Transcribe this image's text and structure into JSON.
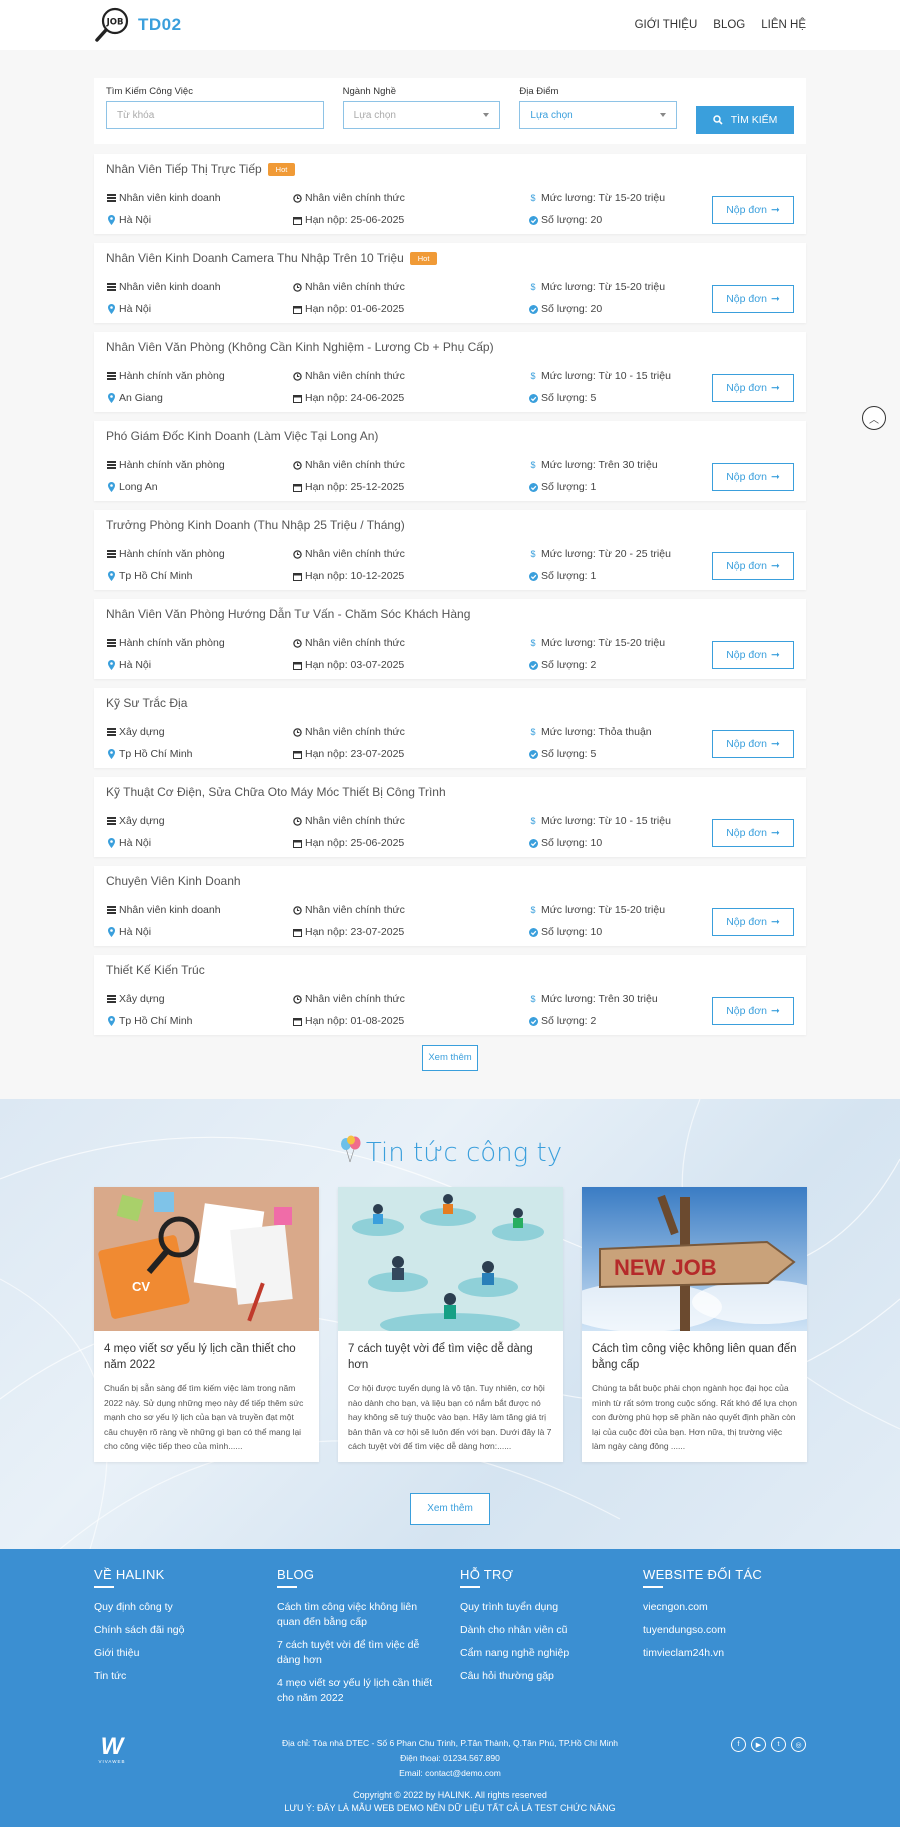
{
  "header": {
    "brand": "TD02",
    "logo_text": "JOB",
    "nav": [
      "GIỚI THIỆU",
      "BLOG",
      "LIÊN HỆ"
    ]
  },
  "search": {
    "keyword_label": "Tìm Kiếm Công Việc",
    "keyword_placeholder": "Từ khóa",
    "industry_label": "Ngành Nghề",
    "industry_value": "Lựa chọn",
    "location_label": "Địa Điểm",
    "location_value": "Lựa chọn",
    "button": "TÌM KIẾM"
  },
  "jobs": [
    {
      "title": "Nhân Viên Tiếp Thị Trực Tiếp",
      "hot": "Hot",
      "category": "Nhân viên kinh doanh",
      "type": "Nhân viên chính thức",
      "salary": "Mức lương: Từ 15-20 triệu",
      "location": "Hà Nội",
      "deadline": "Hạn nộp: 25-06-2025",
      "quantity": "Số lượng: 20",
      "apply": "Nộp đơn"
    },
    {
      "title": "Nhân Viên Kinh Doanh Camera Thu Nhập Trên 10 Triệu",
      "hot": "Hot",
      "category": "Nhân viên kinh doanh",
      "type": "Nhân viên chính thức",
      "salary": "Mức lương: Từ 15-20 triệu",
      "location": "Hà Nội",
      "deadline": "Hạn nộp: 01-06-2025",
      "quantity": "Số lượng: 20",
      "apply": "Nộp đơn"
    },
    {
      "title": "Nhân Viên Văn Phòng (Không Cần Kinh Nghiệm - Lương Cb + Phụ Cấp)",
      "hot": "",
      "category": "Hành chính văn phòng",
      "type": "Nhân viên chính thức",
      "salary": "Mức lương: Từ 10 - 15 triệu",
      "location": "An Giang",
      "deadline": "Hạn nộp: 24-06-2025",
      "quantity": "Số lượng: 5",
      "apply": "Nộp đơn"
    },
    {
      "title": "Phó Giám Đốc Kinh Doanh (Làm Việc Tại Long An)",
      "hot": "",
      "category": "Hành chính văn phòng",
      "type": "Nhân viên chính thức",
      "salary": "Mức lương: Trên 30 triệu",
      "location": "Long An",
      "deadline": "Hạn nộp: 25-12-2025",
      "quantity": "Số lượng: 1",
      "apply": "Nộp đơn"
    },
    {
      "title": "Trưởng Phòng Kinh Doanh (Thu Nhập 25 Triệu / Tháng)",
      "hot": "",
      "category": "Hành chính văn phòng",
      "type": "Nhân viên chính thức",
      "salary": "Mức lương: Từ 20 - 25 triệu",
      "location": "Tp Hồ Chí Minh",
      "deadline": "Hạn nộp: 10-12-2025",
      "quantity": "Số lượng: 1",
      "apply": "Nộp đơn"
    },
    {
      "title": "Nhân Viên Văn Phòng Hướng Dẫn Tư Vấn - Chăm Sóc Khách Hàng",
      "hot": "",
      "category": "Hành chính văn phòng",
      "type": "Nhân viên chính thức",
      "salary": "Mức lương: Từ 15-20 triệu",
      "location": "Hà Nội",
      "deadline": "Hạn nộp: 03-07-2025",
      "quantity": "Số lượng: 2",
      "apply": "Nộp đơn"
    },
    {
      "title": "Kỹ Sư Trắc Địa",
      "hot": "",
      "category": "Xây dựng",
      "type": "Nhân viên chính thức",
      "salary": "Mức lương: Thỏa thuận",
      "location": "Tp Hồ Chí Minh",
      "deadline": "Hạn nộp: 23-07-2025",
      "quantity": "Số lượng: 5",
      "apply": "Nộp đơn"
    },
    {
      "title": "Kỹ Thuật Cơ Điện, Sửa Chữa Oto Máy Móc Thiết Bị Công Trình",
      "hot": "",
      "category": "Xây dựng",
      "type": "Nhân viên chính thức",
      "salary": "Mức lương: Từ 10 - 15 triệu",
      "location": "Hà Nội",
      "deadline": "Hạn nộp: 25-06-2025",
      "quantity": "Số lượng: 10",
      "apply": "Nộp đơn"
    },
    {
      "title": "Chuyên Viên Kinh Doanh",
      "hot": "",
      "category": "Nhân viên kinh doanh",
      "type": "Nhân viên chính thức",
      "salary": "Mức lương: Từ 15-20 triệu",
      "location": "Hà Nội",
      "deadline": "Hạn nộp: 23-07-2025",
      "quantity": "Số lượng: 10",
      "apply": "Nộp đơn"
    },
    {
      "title": "Thiết Kế Kiến Trúc",
      "hot": "",
      "category": "Xây dựng",
      "type": "Nhân viên chính thức",
      "salary": "Mức lương: Trên 30 triệu",
      "location": "Tp Hồ Chí Minh",
      "deadline": "Hạn nộp: 01-08-2025",
      "quantity": "Số lượng: 2",
      "apply": "Nộp đơn"
    }
  ],
  "jobs_more": "Xem thêm",
  "news": {
    "title": "Tin tức công ty",
    "more": "Xem thêm",
    "items": [
      {
        "title": "4 mẹo viết sơ yếu lý lịch cần thiết cho năm 2022",
        "desc": "Chuẩn bị sẵn sàng để tìm kiếm việc làm trong năm 2022 này. Sử dụng những mẹo này để tiếp thêm sức mạnh cho sơ yếu lý lịch của bạn và truyền đạt một câu chuyện rõ ràng về những gì bạn có thể mang lại cho công việc tiếp theo của mình......",
        "image_text": "CV"
      },
      {
        "title": "7 cách tuyệt vời để tìm việc dễ dàng hơn",
        "desc": "Cơ hội được tuyển dụng là vô tận. Tuy nhiên, cơ hội nào dành cho bạn, và liệu bạn có nắm bắt được nó hay không sẽ tuỳ thuộc vào bạn. Hãy làm tăng giá trị bản thân và cơ hội sẽ luôn đến với bạn. Dưới đây là 7 cách tuyệt vời để tìm việc dễ dàng hơn:......",
        "image_text": ""
      },
      {
        "title": "Cách tìm công việc không liên quan đến bằng cấp",
        "desc": "Chúng ta bắt buộc phải chọn ngành học đại học của mình từ rất sớm trong cuộc sống. Rất khó để lựa chọn con đường phù hợp sẽ phần nào quyết định phần còn lại của cuộc đời của bạn. Hơn nữa, thị trường việc làm ngày càng đông ......",
        "image_text": "NEW JOB"
      }
    ]
  },
  "footer": {
    "cols": [
      {
        "title": "VỀ HALINK",
        "links": [
          "Quy định công ty",
          "Chính sách đãi ngộ",
          "Giới thiệu",
          "Tin tức"
        ]
      },
      {
        "title": "BLOG",
        "links": [
          "Cách tìm công việc không liên quan đến bằng cấp",
          "7 cách tuyệt vời để tìm việc dễ dàng hơn",
          "4 mẹo viết sơ yếu lý lịch cần thiết cho năm 2022"
        ]
      },
      {
        "title": "HỖ TRỢ",
        "links": [
          "Quy trình tuyển dụng",
          "Dành cho nhân viên cũ",
          "Cẩm nang nghề nghiệp",
          "Câu hỏi thường gặp"
        ]
      },
      {
        "title": "WEBSITE ĐỐI TÁC",
        "links": [
          "viecngon.com",
          "tuyendungso.com",
          "timvieclam24h.vn"
        ]
      }
    ],
    "logo_mark": "W",
    "logo_name": "VIVAWEB",
    "address": "Địa chỉ: Tòa nhà DTEC - Số 6 Phan Chu Trinh, P.Tân Thành, Q.Tân Phú, TP.Hồ Chí Minh",
    "phone": "Điện thoại: 01234.567.890",
    "email": "Email: contact@demo.com",
    "copyright": "Copyright © 2022 by HALINK. All rights reserved",
    "notice": "LƯU Ý: ĐÂY LÀ MẪU WEB DEMO NÊN DỮ LIỆU TẤT CẢ LÀ TEST CHỨC NĂNG",
    "social_icons": [
      "facebook-icon",
      "youtube-icon",
      "twitter-icon",
      "instagram-icon"
    ]
  },
  "colors": {
    "accent": "#3a9fdc",
    "hot": "#f09a36",
    "footer": "#3b8fd2"
  }
}
